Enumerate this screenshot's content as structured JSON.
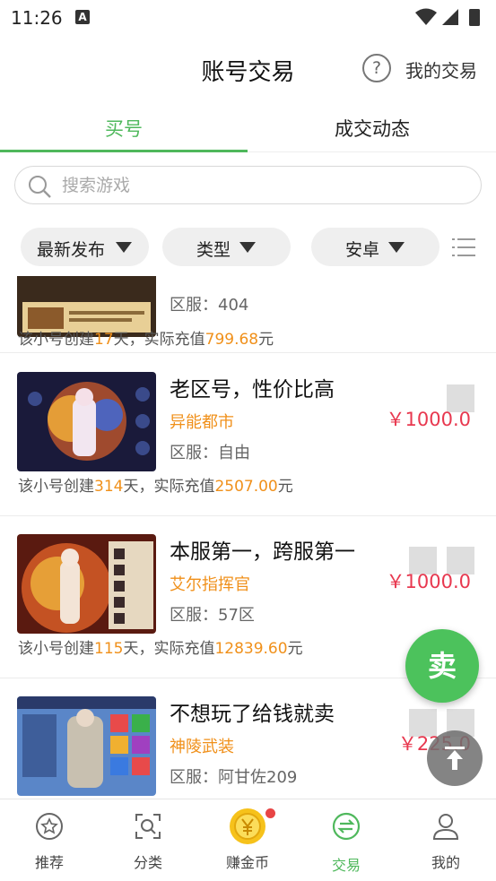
{
  "status_bar": {
    "time": "11:26",
    "notification_letter": "A"
  },
  "header": {
    "title": "账号交易",
    "help_glyph": "?",
    "my_trades": "我的交易"
  },
  "tabs": [
    {
      "label": "买号",
      "active": true
    },
    {
      "label": "成交动态",
      "active": false
    }
  ],
  "search": {
    "placeholder": "搜索游戏"
  },
  "filters": [
    {
      "label": "最新发布"
    },
    {
      "label": "类型"
    },
    {
      "label": "安卓"
    }
  ],
  "listings": [
    {
      "title": "",
      "game": "",
      "server": "区服：404",
      "meta_prefix": "该小号创建",
      "days": "17",
      "meta_mid": "天，实际充值",
      "amount": "799.68",
      "meta_suffix": "元",
      "price": ""
    },
    {
      "title": "老区号，性价比高",
      "game": "异能都市",
      "server": "区服：自由",
      "meta_prefix": "该小号创建",
      "days": "314",
      "meta_mid": "天，实际充值",
      "amount": "2507.00",
      "meta_suffix": "元",
      "price": "￥1000.0"
    },
    {
      "title": "本服第一，跨服第一",
      "game": "艾尔指挥官",
      "server": "区服：57区",
      "meta_prefix": "该小号创建",
      "days": "115",
      "meta_mid": "天，实际充值",
      "amount": "12839.60",
      "meta_suffix": "元",
      "price": "￥1000.0"
    },
    {
      "title": "不想玩了给钱就卖",
      "game": "神陵武装",
      "server": "区服：阿甘佐209",
      "price": "￥225.0"
    }
  ],
  "floating": {
    "sell_label": "卖"
  },
  "bottom_nav": [
    {
      "label": "推荐",
      "icon": "star-circle-icon"
    },
    {
      "label": "分类",
      "icon": "category-search-icon"
    },
    {
      "label": "赚金币",
      "icon": "gold-coin-icon"
    },
    {
      "label": "交易",
      "icon": "exchange-icon",
      "active": true
    },
    {
      "label": "我的",
      "icon": "user-icon"
    }
  ],
  "colors": {
    "accent": "#4fb85c",
    "price": "#e8384f",
    "highlight": "#f0901a"
  }
}
